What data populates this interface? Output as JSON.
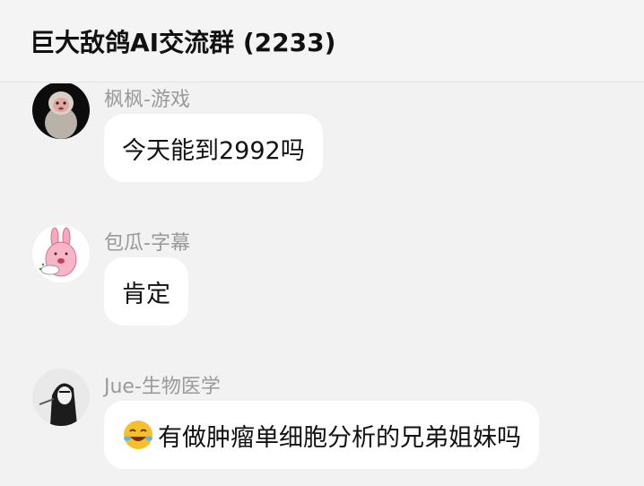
{
  "header": {
    "title": "巨大敌鸽AI交流群 (2233)"
  },
  "messages": [
    {
      "sender": "枫枫-游戏",
      "text": "今天能到2992吗",
      "avatar_icon": "monkey-avatar"
    },
    {
      "sender": "包瓜-字幕",
      "text": "肯定",
      "avatar_icon": "pink-bunny-avatar"
    },
    {
      "sender": "Jue-生物医学",
      "text": "有做肿瘤单细胞分析的兄弟姐妹吗",
      "avatar_icon": "masked-figure-avatar",
      "emoji": "laughing-crying-face-icon"
    }
  ],
  "colors": {
    "background": "#f2f2f2",
    "bubble": "#ffffff",
    "sender": "#9a9a9a"
  }
}
